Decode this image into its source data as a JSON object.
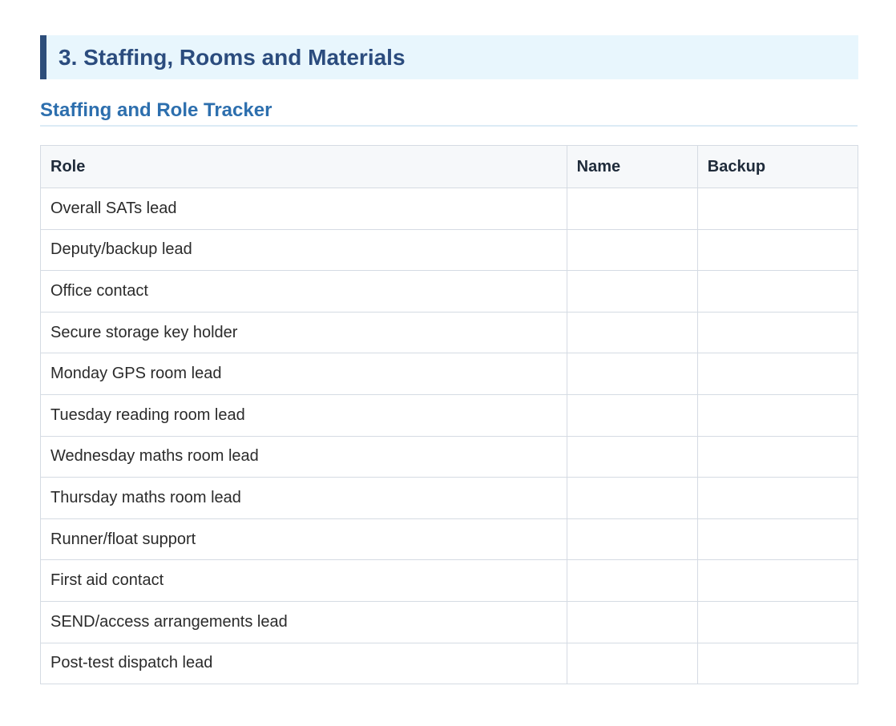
{
  "section": {
    "title": "3. Staffing, Rooms and Materials"
  },
  "subsection": {
    "title": "Staffing and Role Tracker"
  },
  "table": {
    "headers": [
      "Role",
      "Name",
      "Backup"
    ],
    "rows": [
      {
        "role": "Overall SATs lead",
        "name": "",
        "backup": ""
      },
      {
        "role": "Deputy/backup lead",
        "name": "",
        "backup": ""
      },
      {
        "role": "Office contact",
        "name": "",
        "backup": ""
      },
      {
        "role": "Secure storage key holder",
        "name": "",
        "backup": ""
      },
      {
        "role": "Monday GPS room lead",
        "name": "",
        "backup": ""
      },
      {
        "role": "Tuesday reading room lead",
        "name": "",
        "backup": ""
      },
      {
        "role": "Wednesday maths room lead",
        "name": "",
        "backup": ""
      },
      {
        "role": "Thursday maths room lead",
        "name": "",
        "backup": ""
      },
      {
        "role": "Runner/float support",
        "name": "",
        "backup": ""
      },
      {
        "role": "First aid contact",
        "name": "",
        "backup": ""
      },
      {
        "role": "SEND/access arrangements lead",
        "name": "",
        "backup": ""
      },
      {
        "role": "Post-test dispatch lead",
        "name": "",
        "backup": ""
      }
    ]
  },
  "colors": {
    "banner_background": "#e8f6fd",
    "banner_accent": "#2d4e7a",
    "section_title": "#2b4c7e",
    "subsection_title": "#2d6fae",
    "table_border": "#d5dbe3",
    "header_background": "#f6f8fa"
  }
}
